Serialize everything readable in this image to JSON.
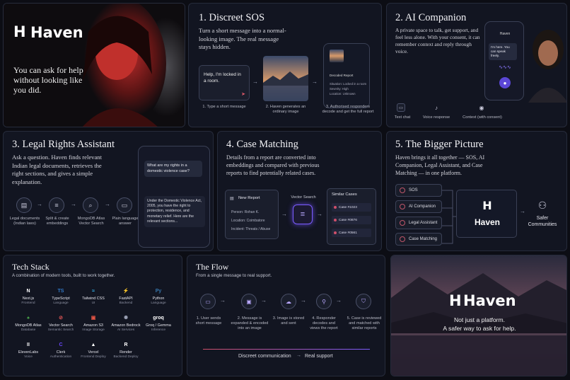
{
  "hero": {
    "brand": "Haven",
    "tagline": "You can ask for help without looking like you did."
  },
  "sos": {
    "title": "1. Discreet SOS",
    "desc": "Turn a short message into a normal-looking image. The real message stays hidden.",
    "message": "Help, I'm locked in a room.",
    "report_title": "Decoded Report",
    "report_lines": [
      "Situation: Locked in a room",
      "Severity: High",
      "Location: Unknown"
    ],
    "steps": [
      "1. Type a short message",
      "2. Haven generates an ordinary image",
      "3. Authorised responders decode and get the full report"
    ]
  },
  "companion": {
    "title": "2. AI Companion",
    "desc": "A private space to talk, get support, and feel less alone. With your consent, it can remember context and reply through voice.",
    "phone_brand": "Haven",
    "bubble": "I'm here. You can speak freely.",
    "features": [
      "Text chat",
      "Voice response",
      "Context (with consent)"
    ]
  },
  "legal": {
    "title": "3. Legal Rights Assistant",
    "desc": "Ask a question. Haven finds relevant Indian legal documents, retrieves the right sections, and gives a simple explanation.",
    "steps": [
      "Legal documents (Indian laws)",
      "Split & create embeddings",
      "MongoDB Atlas Vector Search",
      "Plain language answer"
    ],
    "question": "What are my rights in a domestic violence case?",
    "answer": "Under the Domestic Violence Act, 2005, you have the right to protection, residence, and monetary relief. Here are the relevant sections..."
  },
  "matching": {
    "title": "4. Case Matching",
    "desc": "Details from a report are converted into embeddings and compared with previous reports to find potentially related cases.",
    "report_title": "New Report",
    "report_lines": [
      "Person: Rohan K.",
      "Location: Coimbatore",
      "Incident: Threats / Abuse"
    ],
    "vector_label": "Vector Search",
    "similar_title": "Similar Cases",
    "cases": [
      "Case #1023",
      "Case #0876",
      "Case #0561"
    ]
  },
  "bigger": {
    "title": "5. The Bigger Picture",
    "desc": "Haven brings it all together — SOS, AI Companion, Legal Assistant, and Case Matching — in one platform.",
    "items": [
      "SOS",
      "AI Companion",
      "Legal Assistant",
      "Case Matching"
    ],
    "brand": "Haven",
    "outcome": "Safer Communities"
  },
  "stack": {
    "title": "Tech Stack",
    "subtitle": "A combination of modern tools, built to work together.",
    "items": [
      {
        "name": "Next.js",
        "role": "Frontend",
        "glyph": "N",
        "color": "#ffffff"
      },
      {
        "name": "TypeScript",
        "role": "Language",
        "glyph": "TS",
        "color": "#3178c6"
      },
      {
        "name": "Tailwind CSS",
        "role": "UI",
        "glyph": "≈",
        "color": "#38bdf8"
      },
      {
        "name": "FastAPI",
        "role": "Backend",
        "glyph": "⚡",
        "color": "#059669"
      },
      {
        "name": "Python",
        "role": "Language",
        "glyph": "Py",
        "color": "#3776ab"
      },
      {
        "name": "MongoDB Atlas",
        "role": "Database",
        "glyph": "♠",
        "color": "#47a248"
      },
      {
        "name": "Vector Search",
        "role": "Semantic Search",
        "glyph": "⊘",
        "color": "#e05555"
      },
      {
        "name": "Amazon S3",
        "role": "Image Storage",
        "glyph": "▣",
        "color": "#e25444"
      },
      {
        "name": "Amazon Bedrock",
        "role": "AI Services",
        "glyph": "✺",
        "color": "#9aa0b4"
      },
      {
        "name": "Groq / Gemma",
        "role": "Inference",
        "glyph": "groq",
        "color": "#ffffff"
      },
      {
        "name": "ElevenLabs",
        "role": "Voice",
        "glyph": "II",
        "color": "#ffffff"
      },
      {
        "name": "Clerk",
        "role": "Authentication",
        "glyph": "C",
        "color": "#6c47ff"
      },
      {
        "name": "Vercel",
        "role": "Frontend Deploy",
        "glyph": "▲",
        "color": "#ffffff"
      },
      {
        "name": "Render",
        "role": "Backend Deploy",
        "glyph": "R",
        "color": "#ffffff"
      }
    ]
  },
  "flow": {
    "title": "The Flow",
    "subtitle": "From a single message to real support.",
    "steps": [
      "1. User sends short message",
      "2. Message is expanded & encoded into an image",
      "3. Image is stored and sent",
      "4. Responder decodes and views the report",
      "5. Case is reviewed and matched with similar reports"
    ],
    "footer_left": "Discreet communication",
    "footer_right": "Real support"
  },
  "closing": {
    "brand": "Haven",
    "line1": "Not just a platform.",
    "line2": "A safer way to ask for help."
  },
  "colors": {
    "accent": "#7c5cff",
    "alert": "#d0506a",
    "panel": "#121521"
  }
}
